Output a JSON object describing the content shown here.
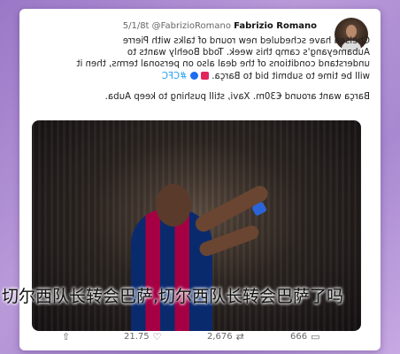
{
  "tweet": {
    "author_name": "Fabrizio Romano",
    "handle": "@FabrizioRomano",
    "date": "5/1/8t",
    "text_lines": [
      "Chelsea have scheduled new round of talks with Pierre",
      "Aubameyang's camp this week. Todd Boehly wants to",
      "understand conditions of the deal also on personal terms, then it",
      "will be time to submit bid to Barça."
    ],
    "hashtag": "#CFC",
    "second_paragraph": "Barça want around €30m. Xavi, still pushing to keep Auba."
  },
  "actions": {
    "reply_icon": "reply-icon",
    "reply_count": "666",
    "retweet_icon": "retweet-icon",
    "retweet_count": "2,676",
    "like_icon": "heart-icon",
    "like_count": "21.75",
    "share_icon": "share-icon"
  },
  "overlay": {
    "title": "切尔西队长转会巴萨,切尔西队长转会巴萨了吗"
  }
}
